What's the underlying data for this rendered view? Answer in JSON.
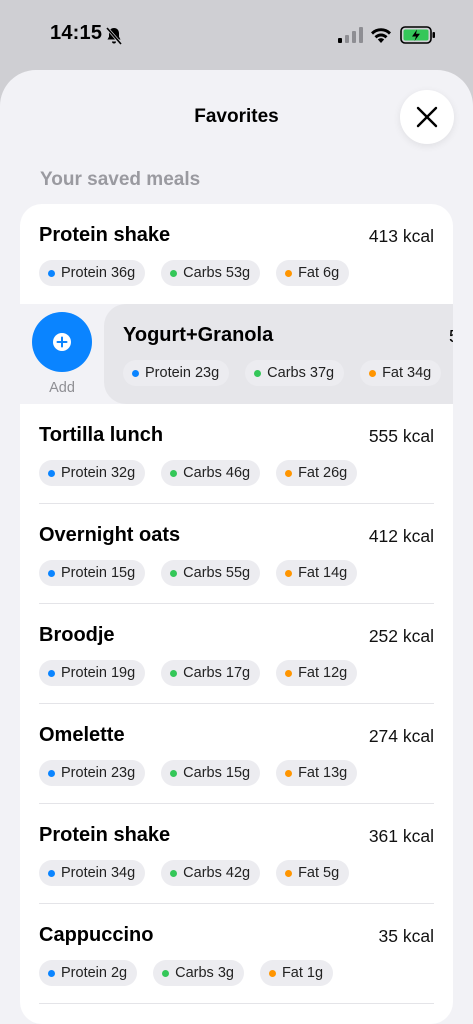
{
  "status": {
    "time": "14:15"
  },
  "sheet": {
    "title": "Favorites",
    "section_label": "Your saved meals"
  },
  "swipe": {
    "action_label": "Add",
    "meal": {
      "name": "Yogurt+Granola",
      "kcal_peek": "5",
      "protein": "Protein 23g",
      "carbs": "Carbs 37g",
      "fat": "Fat 34g"
    }
  },
  "meals": [
    {
      "name": "Protein shake",
      "kcal": "413 kcal",
      "protein": "Protein 36g",
      "carbs": "Carbs 53g",
      "fat": "Fat 6g"
    },
    {
      "name": "Tortilla lunch",
      "kcal": "555 kcal",
      "protein": "Protein 32g",
      "carbs": "Carbs 46g",
      "fat": "Fat 26g"
    },
    {
      "name": "Overnight oats",
      "kcal": "412 kcal",
      "protein": "Protein 15g",
      "carbs": "Carbs 55g",
      "fat": "Fat 14g"
    },
    {
      "name": "Broodje",
      "kcal": "252 kcal",
      "protein": "Protein 19g",
      "carbs": "Carbs 17g",
      "fat": "Fat 12g"
    },
    {
      "name": "Omelette",
      "kcal": "274 kcal",
      "protein": "Protein 23g",
      "carbs": "Carbs 15g",
      "fat": "Fat 13g"
    },
    {
      "name": "Protein shake",
      "kcal": "361 kcal",
      "protein": "Protein 34g",
      "carbs": "Carbs 42g",
      "fat": "Fat 5g"
    },
    {
      "name": "Cappuccino",
      "kcal": "35 kcal",
      "protein": "Protein 2g",
      "carbs": "Carbs 3g",
      "fat": "Fat 1g"
    }
  ],
  "colors": {
    "protein": "#0a84ff",
    "carbs": "#34c759",
    "fat": "#ff9500",
    "accent": "#0a84ff"
  }
}
